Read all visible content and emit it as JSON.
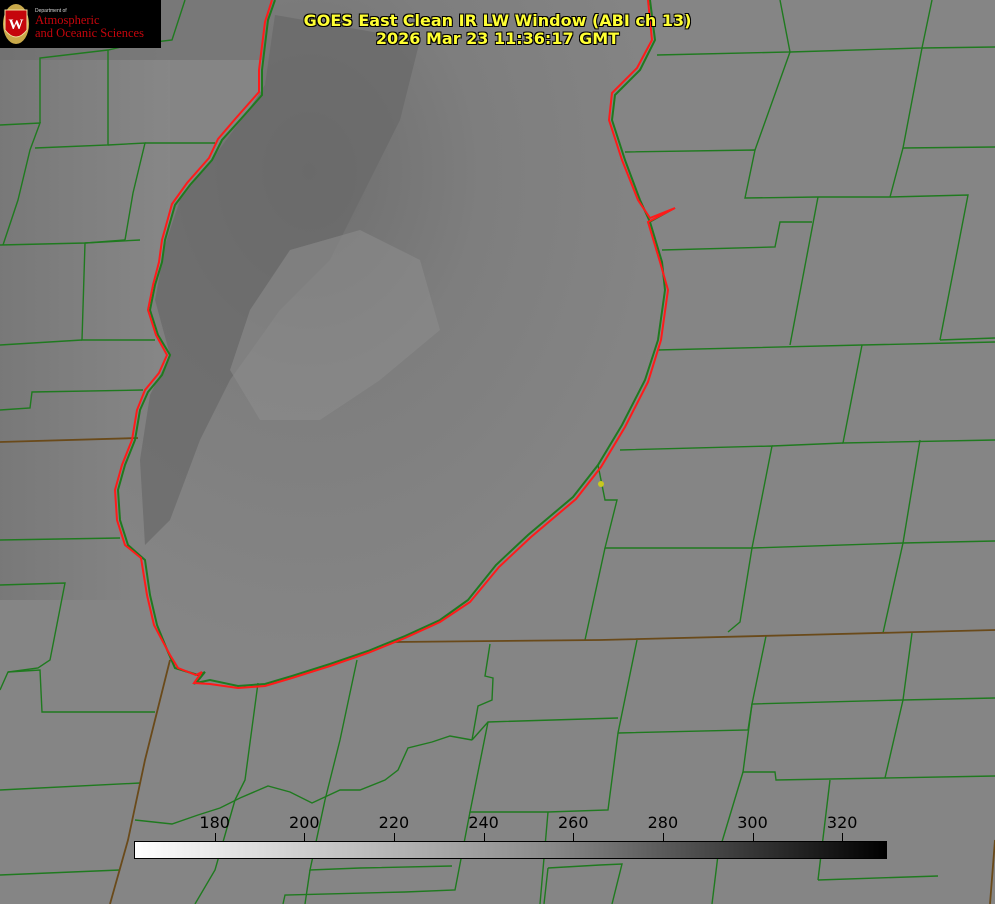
{
  "title": {
    "line1": "GOES East Clean IR LW Window (ABI ch 13)",
    "line2": "2026 Mar 23 11:36:17 GMT"
  },
  "logo": {
    "department": "Department of",
    "line1": "Atmospheric",
    "line2": "and Oceanic Sciences",
    "crest_letter": "W",
    "brand_color": "#c5050c"
  },
  "colorbar": {
    "units_hint": "",
    "min": 162,
    "max": 330,
    "ticks": [
      {
        "value": 180,
        "label": "180"
      },
      {
        "value": 200,
        "label": "200"
      },
      {
        "value": 220,
        "label": "220"
      },
      {
        "value": 240,
        "label": "240"
      },
      {
        "value": 260,
        "label": "260"
      },
      {
        "value": 280,
        "label": "280"
      },
      {
        "value": 300,
        "label": "300"
      },
      {
        "value": 320,
        "label": "320"
      }
    ],
    "gradient": "white-to-black"
  },
  "map": {
    "shoreline_color": "#ff1a1a",
    "boundary_color": "#1f7a1f",
    "state_line_color": "#6a4a1a",
    "marker_color": "#c8c81e"
  }
}
